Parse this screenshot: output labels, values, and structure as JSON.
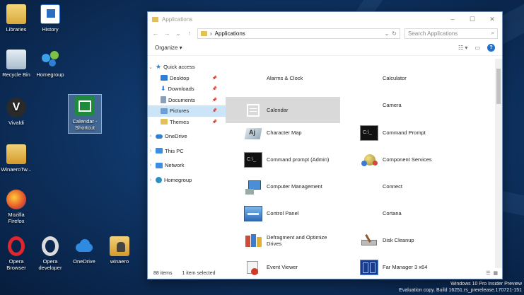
{
  "desktop": {
    "icons": [
      {
        "label": "Libraries"
      },
      {
        "label": "History"
      },
      {
        "label": "Recycle Bin"
      },
      {
        "label": "Homegroup"
      },
      {
        "label": "Vivaldi"
      },
      {
        "label": "Calendar - Shortcut"
      },
      {
        "label": "WinaeroTw..."
      },
      {
        "label": "Mozilla Firefox"
      },
      {
        "label": "Opera Browser"
      },
      {
        "label": "Opera developer"
      },
      {
        "label": "OneDrive"
      },
      {
        "label": "winaero"
      }
    ]
  },
  "window": {
    "title": "Applications",
    "controls": {
      "minimize": "–",
      "maximize": "☐",
      "close": "✕"
    },
    "address": {
      "separator": "›",
      "path": "Applications"
    },
    "search": {
      "placeholder": "Search Applications"
    },
    "command_bar": {
      "organize": "Organize ▾"
    },
    "nav": {
      "quick_access": "Quick access",
      "items": [
        {
          "label": "Desktop",
          "color": "#2f7fd6"
        },
        {
          "label": "Downloads",
          "color": "#2f7fd6"
        },
        {
          "label": "Documents",
          "color": "#8aa0b8"
        },
        {
          "label": "Pictures",
          "color": "#6a9fd4"
        },
        {
          "label": "Themes",
          "color": "#e2c05a"
        }
      ],
      "roots": [
        {
          "label": "OneDrive",
          "color": "#2f7fd6"
        },
        {
          "label": "This PC",
          "color": "#3a8ee6"
        },
        {
          "label": "Network",
          "color": "#3a8ee6"
        },
        {
          "label": "Homegroup",
          "color": "#2f8ec0"
        }
      ]
    },
    "apps": [
      {
        "label": "Alarms & Clock",
        "icon": "none"
      },
      {
        "label": "Calculator",
        "icon": "none"
      },
      {
        "label": "Calendar",
        "icon": "calendar-icon"
      },
      {
        "label": "Camera",
        "icon": "none"
      },
      {
        "label": "Character Map",
        "icon": "character-map-icon"
      },
      {
        "label": "Command Prompt",
        "icon": "command-prompt-icon"
      },
      {
        "label": "Command prompt (Admin)",
        "icon": "command-prompt-admin-icon"
      },
      {
        "label": "Component Services",
        "icon": "component-services-icon"
      },
      {
        "label": "Computer Management",
        "icon": "computer-management-icon"
      },
      {
        "label": "Connect",
        "icon": "none"
      },
      {
        "label": "Control Panel",
        "icon": "control-panel-icon"
      },
      {
        "label": "Cortana",
        "icon": "none"
      },
      {
        "label": "Defragment and Optimize Drives",
        "icon": "defragment-icon"
      },
      {
        "label": "Disk Cleanup",
        "icon": "disk-cleanup-icon"
      },
      {
        "label": "Event Viewer",
        "icon": "event-viewer-icon"
      },
      {
        "label": "Far Manager 3 x64",
        "icon": "far-manager-icon"
      }
    ],
    "status": {
      "items": "88 items",
      "selected": "1 item selected"
    }
  },
  "watermark": {
    "line1": "Windows 10 Pro Insider Preview",
    "line2": "Evaluation copy. Build 16251.rs_prerelease.170721-151"
  }
}
